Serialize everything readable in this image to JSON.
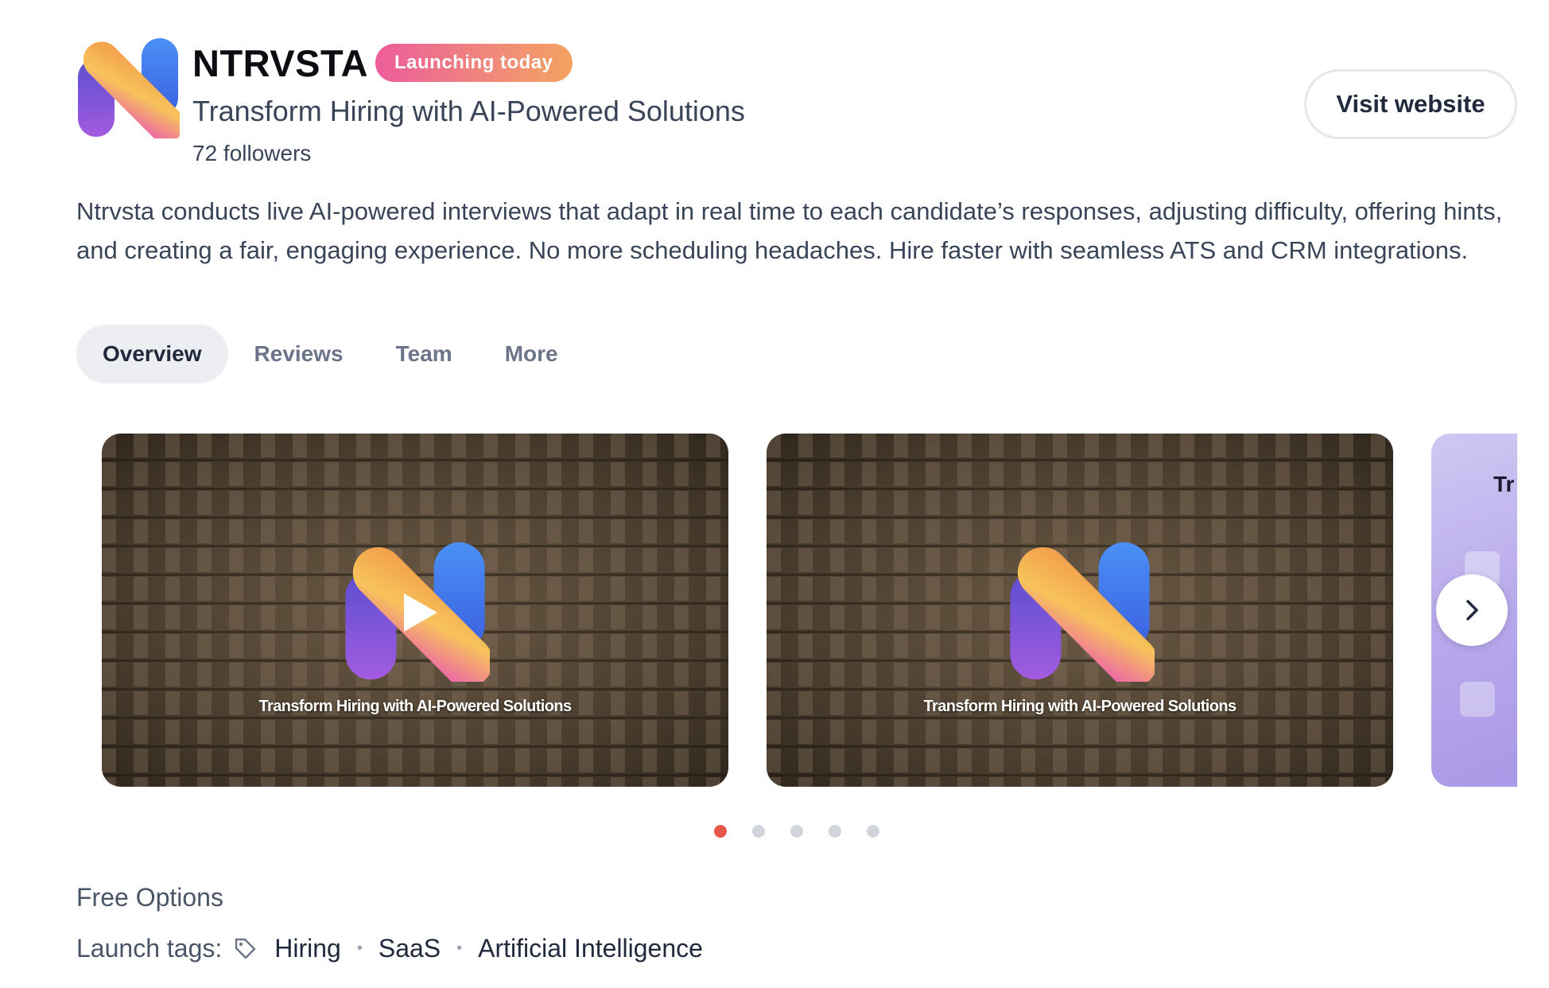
{
  "product": {
    "name": "NTRVSTA",
    "badge": "Launching today",
    "tagline": "Transform Hiring with AI-Powered Solutions",
    "followers": "72 followers",
    "visit_label": "Visit website",
    "description": "Ntrvsta conducts live AI-powered interviews that adapt in real time to each candidate’s responses, adjusting difficulty, offering hints, and creating a fair, engaging experience. No more scheduling headaches. Hire faster with seamless ATS and CRM integrations."
  },
  "tabs": [
    {
      "label": "Overview",
      "active": true
    },
    {
      "label": "Reviews",
      "active": false
    },
    {
      "label": "Team",
      "active": false
    },
    {
      "label": "More",
      "active": false
    }
  ],
  "gallery": {
    "slides": [
      {
        "caption": "Transform Hiring with AI-Powered Solutions",
        "has_play": true
      },
      {
        "caption": "Transform Hiring with AI-Powered Solutions",
        "has_play": false
      },
      {
        "partial_text": "Tr"
      }
    ],
    "dots_total": 5,
    "active_index": 0,
    "next_icon": "chevron-right-icon"
  },
  "pricing": "Free Options",
  "launch_tags": {
    "label": "Launch tags:",
    "icon": "tag-icon",
    "tags": [
      "Hiring",
      "SaaS",
      "Artificial Intelligence"
    ]
  },
  "colors": {
    "accent_dot": "#e8574a",
    "badge_gradient_start": "#ec5c9a",
    "badge_gradient_end": "#f4a261",
    "text_primary": "#21293c"
  }
}
